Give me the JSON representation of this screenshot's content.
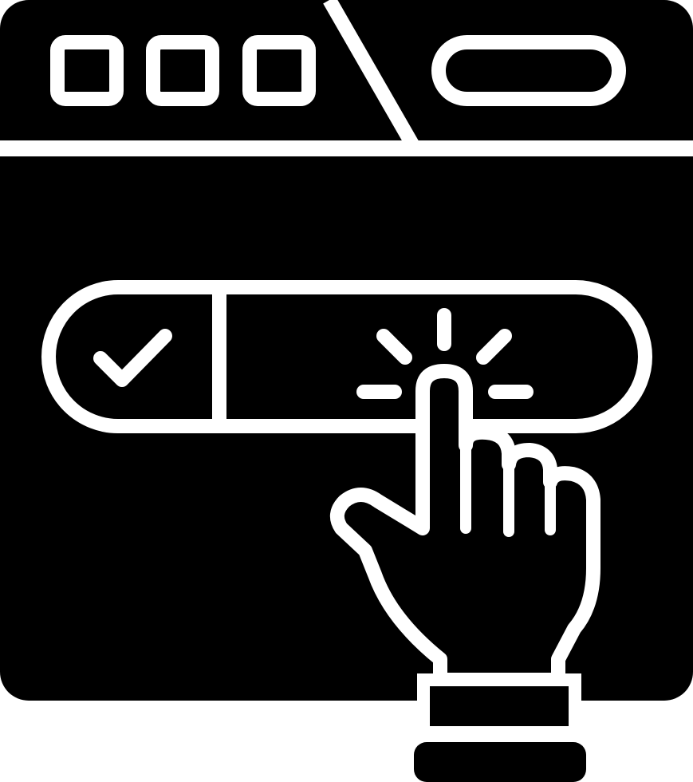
{
  "colors": {
    "fill": "#000000",
    "stroke": "#ffffff"
  },
  "icons": [
    "browser-window-icon",
    "window-control-icon",
    "address-bar-icon",
    "toggle-switch-icon",
    "checkmark-icon",
    "click-burst-icon",
    "pointing-hand-icon"
  ],
  "toggle": {
    "state": "on",
    "selected_segment": "check"
  }
}
